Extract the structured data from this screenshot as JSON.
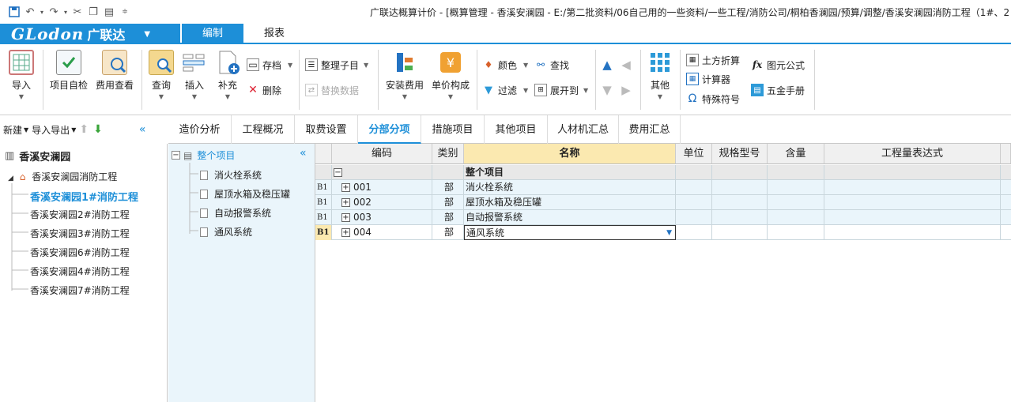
{
  "title": "广联达概算计价 - [概算管理 - 香溪安澜园 - E:/第二批资料/06自己用的一些资料/一些工程/消防公司/桐柏香澜园/预算/调整/香溪安澜园消防工程（1#、2",
  "quick_access": [
    "save-icon",
    "undo-icon",
    "redo-icon",
    "cut-icon",
    "copy-icon",
    "paste-icon",
    "customize-icon"
  ],
  "logo": {
    "brand": "GLodon",
    "cn": "广联达"
  },
  "menu": {
    "edit": "编制",
    "report": "报表"
  },
  "ribbon": {
    "import": "导入",
    "self_check": "项目自检",
    "fee_view": "费用查看",
    "query": "查询",
    "insert": "插入",
    "supplement": "补充",
    "archive": "存档",
    "delete": "删除",
    "organize": "整理子目",
    "replace": "替换数据",
    "install_fee": "安装费用",
    "unit_price": "单价构成",
    "color": "颜色",
    "find": "查找",
    "filter": "过滤",
    "expand": "展开到",
    "other": "其他",
    "earthwork": "土方折算",
    "calculator": "计算器",
    "special_char": "特殊符号",
    "formula": "图元公式",
    "hardware": "五金手册"
  },
  "left_toolbar": {
    "new": "新建",
    "import_export": "导入导出"
  },
  "tree": {
    "root": "香溪安澜园",
    "project": "香溪安澜园消防工程",
    "units": [
      "香溪安澜园1#消防工程",
      "香溪安澜园2#消防工程",
      "香溪安澜园3#消防工程",
      "香溪安澜园6#消防工程",
      "香溪安澜园4#消防工程",
      "香溪安澜园7#消防工程"
    ]
  },
  "content_tabs": [
    "造价分析",
    "工程概况",
    "取费设置",
    "分部分项",
    "措施项目",
    "其他项目",
    "人材机汇总",
    "费用汇总"
  ],
  "mid_tree": {
    "root": "整个项目",
    "items": [
      "消火栓系统",
      "屋顶水箱及稳压罐",
      "自动报警系统",
      "通风系统"
    ]
  },
  "grid": {
    "headers": [
      "编码",
      "类别",
      "名称",
      "单位",
      "规格型号",
      "含量",
      "工程量表达式"
    ],
    "summary": {
      "toggle": "−",
      "name": "整个项目"
    },
    "rows": [
      {
        "tag": "B1",
        "code": "001",
        "type": "部",
        "name": "消火栓系统"
      },
      {
        "tag": "B1",
        "code": "002",
        "type": "部",
        "name": "屋顶水箱及稳压罐"
      },
      {
        "tag": "B1",
        "code": "003",
        "type": "部",
        "name": "自动报警系统"
      },
      {
        "tag": "B1",
        "code": "004",
        "type": "部",
        "name": "通风系统"
      }
    ]
  },
  "colors": {
    "accent": "#1d8fd8",
    "grid_bg": "#eaf5fb",
    "header_sel": "#fbe9b0"
  }
}
